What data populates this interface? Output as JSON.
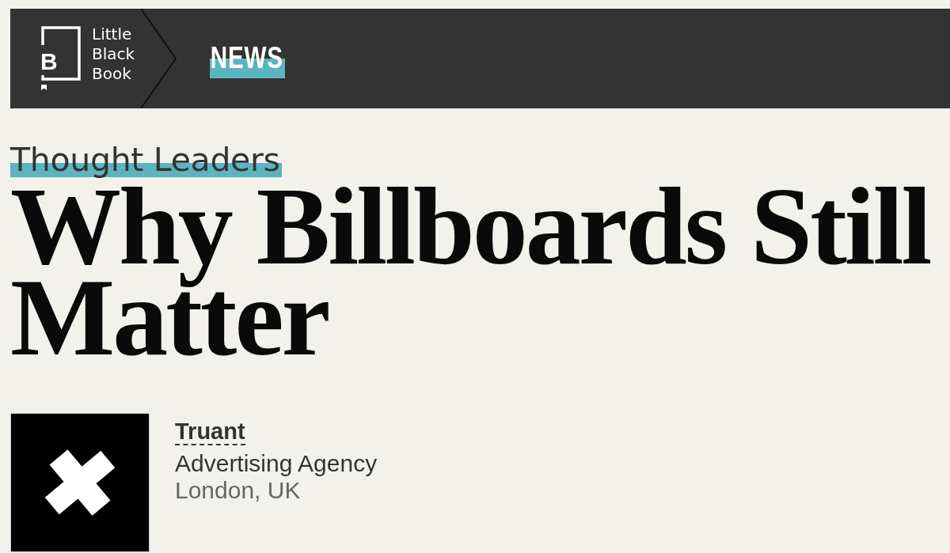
{
  "header": {
    "logo": {
      "letter": "B",
      "lines": [
        "Little",
        "Black",
        "Book"
      ]
    },
    "section": "NEWS"
  },
  "article": {
    "category": "Thought Leaders",
    "title": "Why Billboards Still Matter"
  },
  "company": {
    "name": "Truant",
    "type": "Advertising Agency",
    "location": "London, UK"
  }
}
